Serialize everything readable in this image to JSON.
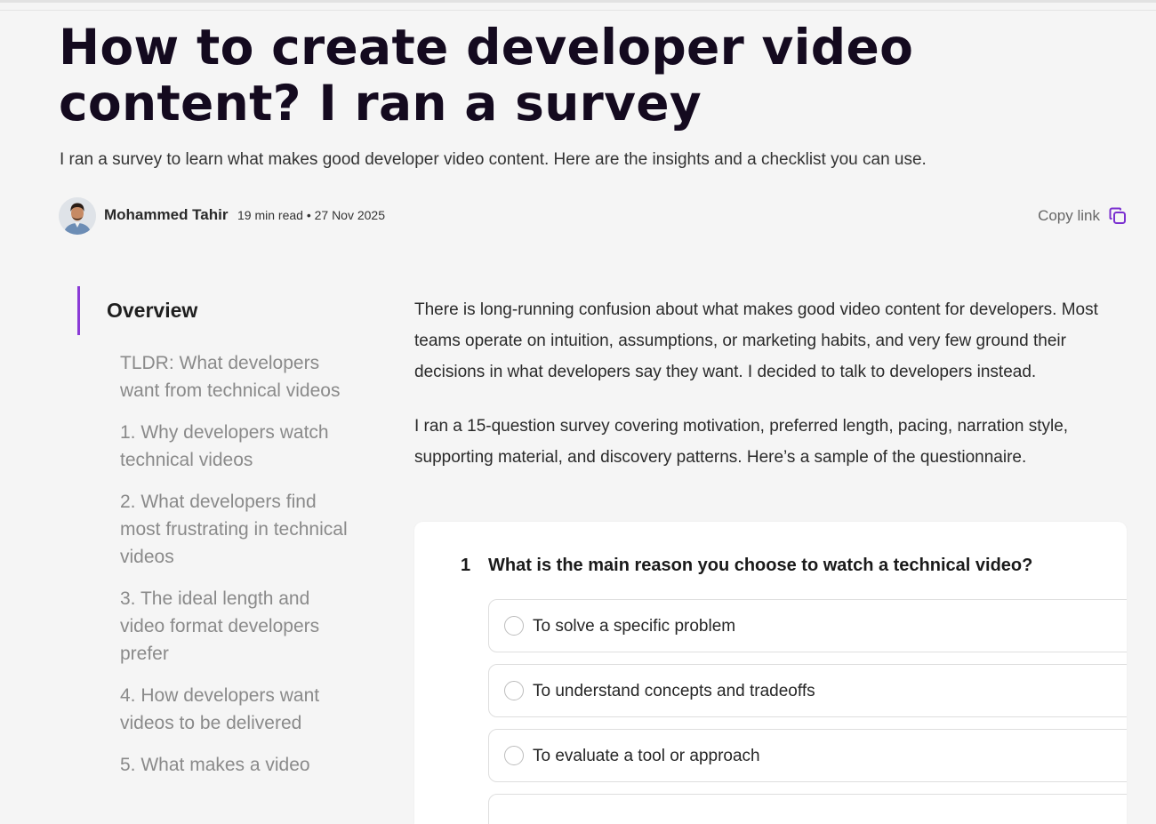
{
  "article": {
    "title": "How to create developer video content? I ran a survey",
    "subtitle": "I ran a survey to learn what makes good developer video content. Here are the insights and a checklist you can use.",
    "author": "Mohammed Tahir",
    "meta": "19 min read • 27 Nov 2025",
    "copy_link_label": "Copy link"
  },
  "toc": {
    "active": "Overview",
    "items": [
      "TLDR: What developers want from technical videos",
      "1. Why developers watch technical videos",
      "2. What developers find most frustrating in technical videos",
      "3. The ideal length and video format developers prefer",
      "4. How developers want videos to be delivered",
      "5. What makes a video"
    ]
  },
  "content": {
    "paragraphs": [
      "There is long-running confusion about what makes good video content for developers. Most teams operate on intuition, assumptions, or marketing habits, and very few ground their decisions in what developers say they want. I decided to talk to developers instead.",
      "I ran a 15-question survey covering motivation, preferred length, pacing, narration style, supporting material, and discovery patterns. Here’s a sample of the questionnaire."
    ]
  },
  "survey": {
    "number": "1",
    "question": "What is the main reason you choose to watch a technical video?",
    "options": [
      "To solve a specific problem",
      "To understand concepts and tradeoffs",
      "To evaluate a tool or approach",
      ""
    ]
  },
  "colors": {
    "accent": "#8a3ad6",
    "background": "#f5f5f5",
    "title": "#140a1f"
  }
}
